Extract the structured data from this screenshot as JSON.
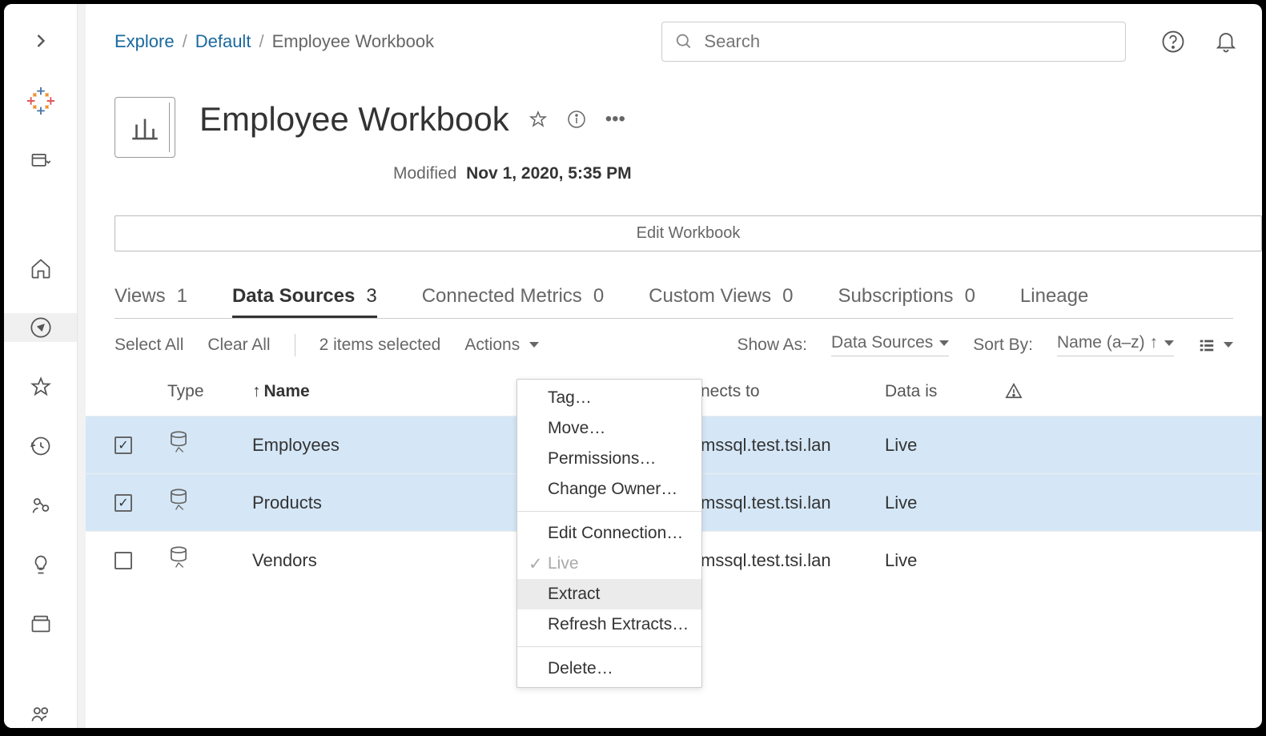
{
  "breadcrumb": {
    "root": "Explore",
    "project": "Default",
    "current": "Employee Workbook"
  },
  "search": {
    "placeholder": "Search"
  },
  "title": "Employee Workbook",
  "modified_label": "Modified",
  "modified_value": "Nov 1, 2020, 5:35 PM",
  "edit_button": "Edit Workbook",
  "tabs": [
    {
      "label": "Views",
      "count": "1"
    },
    {
      "label": "Data Sources",
      "count": "3"
    },
    {
      "label": "Connected Metrics",
      "count": "0"
    },
    {
      "label": "Custom Views",
      "count": "0"
    },
    {
      "label": "Subscriptions",
      "count": "0"
    },
    {
      "label": "Lineage",
      "count": ""
    }
  ],
  "toolbar": {
    "select_all": "Select All",
    "clear_all": "Clear All",
    "selected_text": "2 items selected",
    "actions": "Actions",
    "show_as_label": "Show As:",
    "show_as_value": "Data Sources",
    "sort_by_label": "Sort By:",
    "sort_by_value": "Name (a–z) ↑"
  },
  "columns": {
    "type": "Type",
    "name": "Name",
    "connects": "nects to",
    "datais": "Data is"
  },
  "rows": [
    {
      "name": "Employees",
      "connects": "mssql.test.tsi.lan",
      "datais": "Live",
      "selected": true
    },
    {
      "name": "Products",
      "connects": "mssql.test.tsi.lan",
      "datais": "Live",
      "selected": true
    },
    {
      "name": "Vendors",
      "connects": "mssql.test.tsi.lan",
      "datais": "Live",
      "selected": false
    }
  ],
  "menu": {
    "tag": "Tag…",
    "move": "Move…",
    "permissions": "Permissions…",
    "change_owner": "Change Owner…",
    "edit_connection": "Edit Connection…",
    "live": "Live",
    "extract": "Extract",
    "refresh": "Refresh Extracts…",
    "delete": "Delete…"
  }
}
